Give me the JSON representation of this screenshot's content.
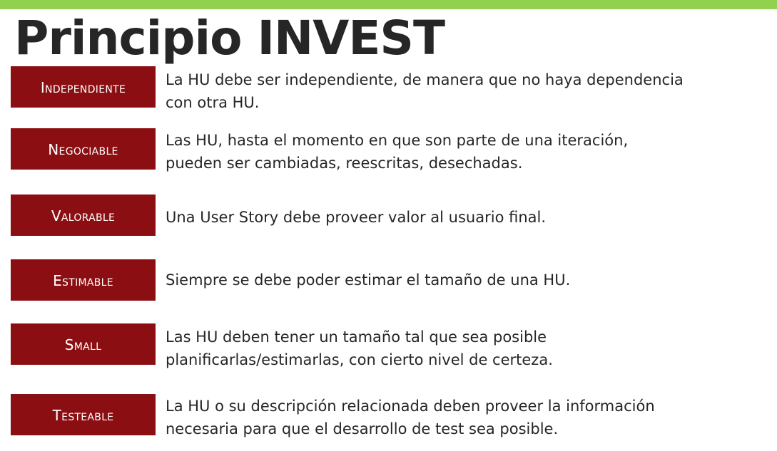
{
  "colors": {
    "accent_bar": "#92d050",
    "badge_bg": "#8b0f12",
    "badge_text": "#ffffff",
    "body_text": "#262626"
  },
  "title": "Principio INVEST",
  "items": [
    {
      "label": "Independiente",
      "lines": [
        "La HU debe ser independiente, de manera que no haya dependencia",
        "con otra HU."
      ]
    },
    {
      "label": "Negociable",
      "lines": [
        "Las HU, hasta el momento en que son parte de una iteración,",
        "pueden ser cambiadas, reescritas, desechadas."
      ]
    },
    {
      "label": "Valorable",
      "lines": [
        "Una User Story debe proveer valor al usuario final."
      ]
    },
    {
      "label": "Estimable",
      "lines": [
        "Siempre se debe poder estimar el tamaño de una HU."
      ]
    },
    {
      "label": "Small",
      "lines": [
        "Las HU deben tener un tamaño tal que sea posible",
        "planificarlas/estimarlas, con cierto nivel de certeza."
      ]
    },
    {
      "label": "Testeable",
      "lines": [
        "La HU o su descripción relacionada deben proveer la información",
        "necesaria para que el desarrollo de test sea posible."
      ]
    }
  ]
}
